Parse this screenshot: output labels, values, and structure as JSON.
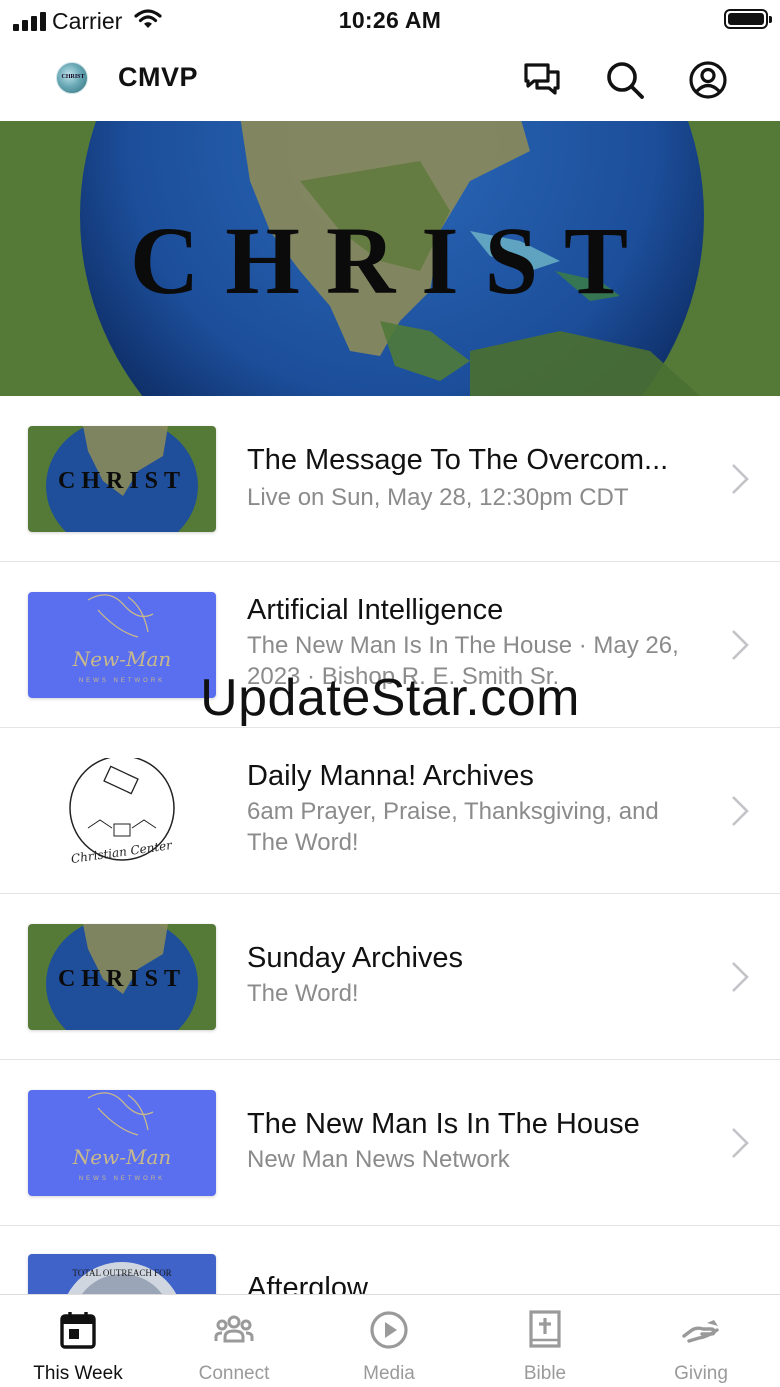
{
  "status_bar": {
    "carrier": "Carrier",
    "time": "10:26 AM"
  },
  "header": {
    "logo_text": "CHRIST",
    "title": "CMVP",
    "icons": [
      "chat-icon",
      "search-icon",
      "profile-icon"
    ]
  },
  "hero": {
    "banner_text": "CHRIST"
  },
  "items": [
    {
      "title": "The Message To The Overcom...",
      "subtitle": "Live on Sun, May 28, 12:30pm CDT",
      "thumb": "christ-globe"
    },
    {
      "title": "Artificial Intelligence",
      "subtitle": "The New Man Is In The House · May 26, 2023 · Bishop R. E. Smith Sr.",
      "thumb": "new-man-news"
    },
    {
      "title": "Daily Manna! Archives",
      "subtitle": "6am Prayer, Praise, Thanksgiving, and The Word!",
      "thumb": "christian-center"
    },
    {
      "title": "Sunday Archives",
      "subtitle": "The Word!",
      "thumb": "christ-globe"
    },
    {
      "title": "The New Man Is In The House",
      "subtitle": "New Man News Network",
      "thumb": "new-man-news"
    },
    {
      "title": "Afterglow",
      "subtitle": "",
      "thumb": "outreach-globe"
    }
  ],
  "thumb_text": {
    "christ": "CHRIST",
    "new_man": "New-Man",
    "news_network": "NEWS NETWORK",
    "christian_center": "Christian Center",
    "outreach": "TOTAL OUTREACH FOR"
  },
  "watermark": "UpdateStar.com",
  "tabs": [
    {
      "label": "This Week",
      "icon": "calendar-icon",
      "active": true
    },
    {
      "label": "Connect",
      "icon": "group-icon",
      "active": false
    },
    {
      "label": "Media",
      "icon": "play-icon",
      "active": false
    },
    {
      "label": "Bible",
      "icon": "bible-icon",
      "active": false
    },
    {
      "label": "Giving",
      "icon": "giving-hand-icon",
      "active": false
    }
  ],
  "colors": {
    "hero_green": "#557a37",
    "globe_blue": "#1f4f9a",
    "new_man_blue": "#5a6ff0",
    "muted": "#8b8b8b"
  }
}
